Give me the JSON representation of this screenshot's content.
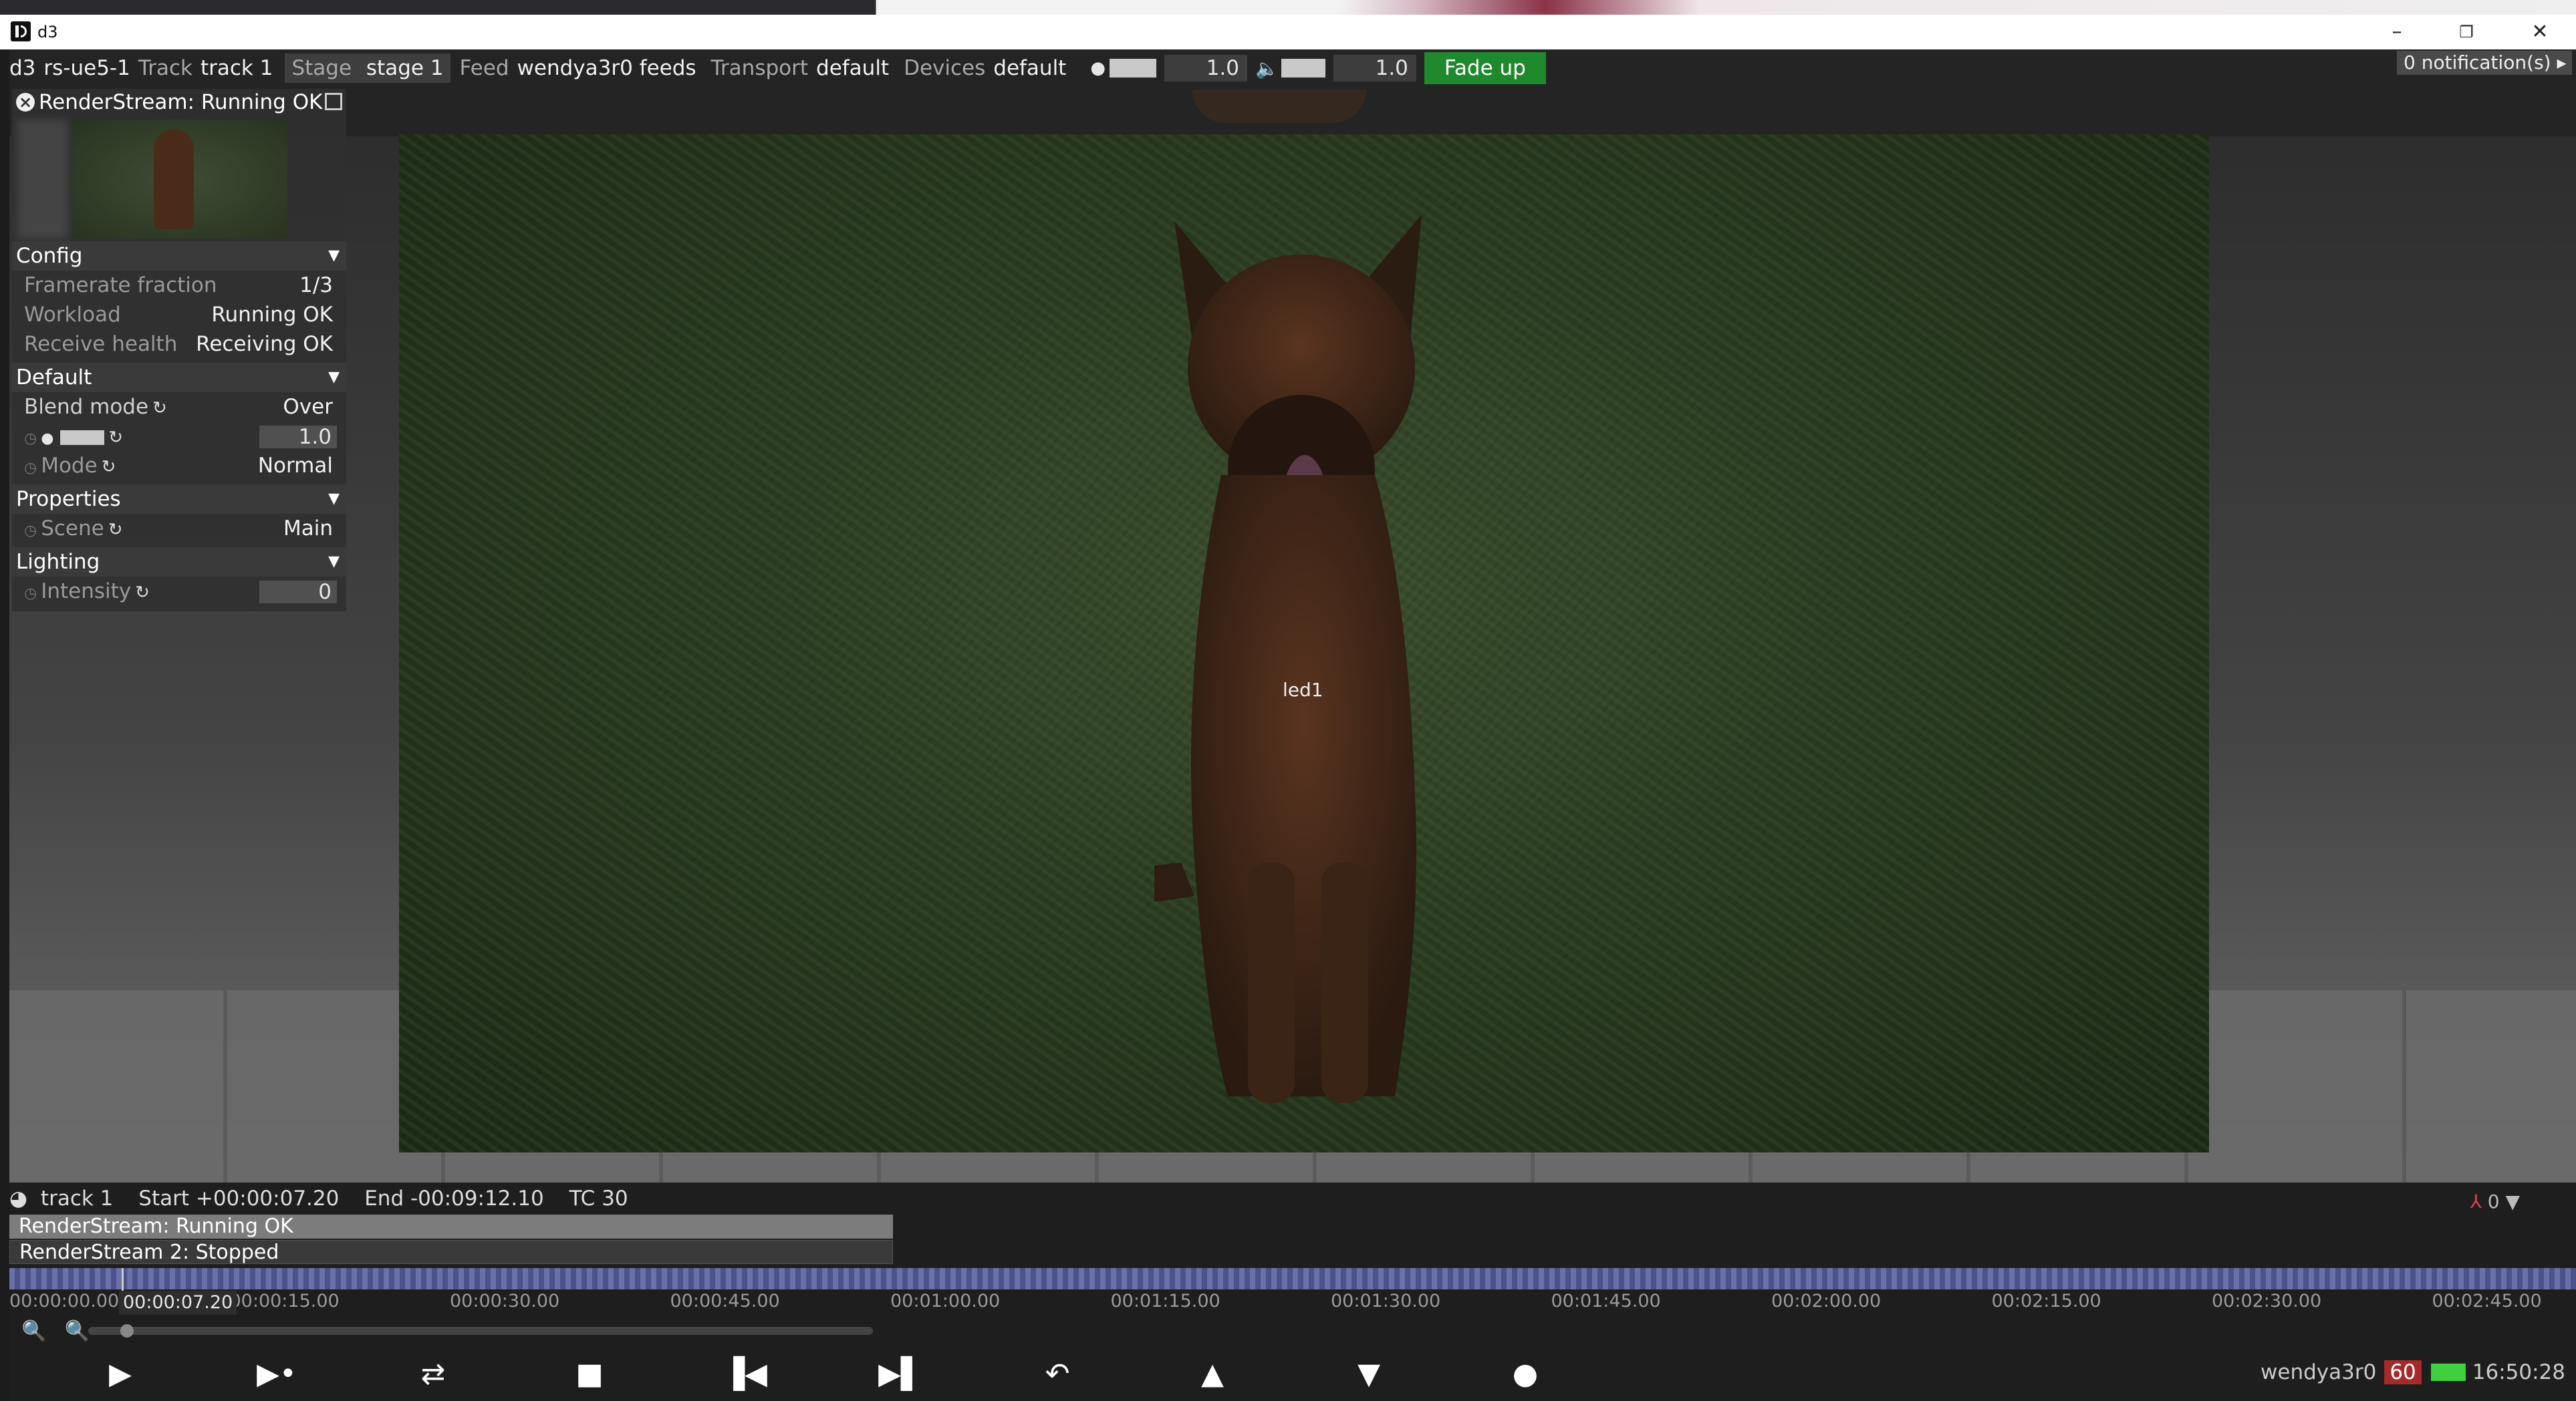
{
  "window": {
    "title": "d3"
  },
  "menubar": {
    "app": "d3",
    "project": "rs-ue5-1",
    "track_key": "Track",
    "track_val": "track 1",
    "stage_key": "Stage",
    "stage_val": "stage 1",
    "feed_key": "Feed",
    "feed_val": "wendya3r0 feeds",
    "transport_key": "Transport",
    "transport_val": "default",
    "devices_key": "Devices",
    "devices_val": "default",
    "brightness_val": "1.0",
    "volume_val": "1.0",
    "fade_label": "Fade up",
    "brightness_level": 1.0,
    "volume_level": 1.0
  },
  "notifications": {
    "label": "0 notification(s)"
  },
  "viewport": {
    "led_label": "led1"
  },
  "panel": {
    "title": "RenderStream: Running OK",
    "config": {
      "label": "Config",
      "rows": [
        {
          "label": "Framerate fraction",
          "value": "1/3"
        },
        {
          "label": "Workload",
          "value": "Running OK"
        },
        {
          "label": "Receive health",
          "value": "Receiving OK"
        }
      ]
    },
    "default": {
      "label": "Default",
      "blend_label": "Blend mode",
      "blend_value": "Over",
      "brightness_value": "1.0",
      "mode_label": "Mode",
      "mode_value": "Normal"
    },
    "properties": {
      "label": "Properties",
      "scene_label": "Scene",
      "scene_value": "Main"
    },
    "lighting": {
      "label": "Lighting",
      "intensity_label": "Intensity",
      "intensity_value": "0"
    }
  },
  "timeline": {
    "track": "track 1",
    "start": "Start +00:00:07.20",
    "end": "End -00:09:12.10",
    "tc": "TC 30",
    "lane1": "RenderStream: Running OK",
    "lane2": "RenderStream 2: Stopped",
    "current_time": "00:00:07.20",
    "ticks": [
      "00:00:00.00",
      "00:00:15.00",
      "00:00:30.00",
      "00:00:45.00",
      "00:01:00.00",
      "00:01:15.00",
      "00:01:30.00",
      "00:01:45.00",
      "00:02:00.00",
      "00:02:15.00",
      "00:02:30.00",
      "00:02:45.00"
    ],
    "axis_count": "0"
  },
  "status": {
    "user": "wendya3r0",
    "fps": "60",
    "clock": "16:50:28"
  }
}
